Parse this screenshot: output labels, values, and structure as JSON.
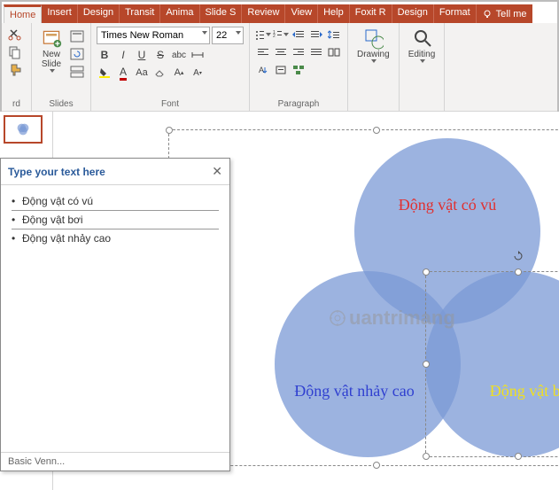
{
  "tabs": {
    "home": "Home",
    "insert": "Insert",
    "design": "Design",
    "transit": "Transit",
    "anima": "Anima",
    "slides": "Slide S",
    "review": "Review",
    "view": "View",
    "help": "Help",
    "foxit": "Foxit R",
    "design2": "Design",
    "format": "Format",
    "tellme": "Tell me"
  },
  "ribbon": {
    "clipboard_label": "rd",
    "new_slide": "New\nSlide",
    "slides_label": "Slides",
    "font_name": "Times New Roman",
    "font_size": "22",
    "font_label": "Font",
    "paragraph_label": "Paragraph",
    "drawing_label": "Drawing",
    "editing_label": "Editing"
  },
  "text_pane": {
    "title": "Type your text here",
    "items": [
      "Động vật có vú",
      "Động vật bơi",
      "Động vật nhảy cao"
    ],
    "footer": "Basic Venn..."
  },
  "venn": {
    "c1": "Động vật có vú",
    "c2": "Động vật nhảy cao",
    "c3": "Động vật bơi"
  },
  "watermark": "uantrimang"
}
